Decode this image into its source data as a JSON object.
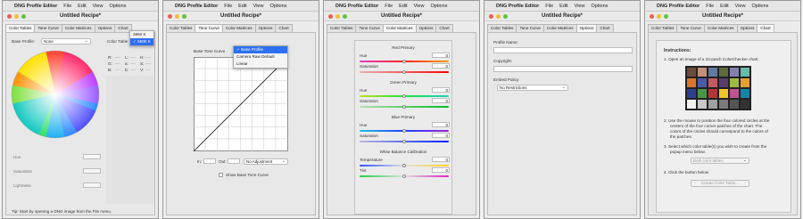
{
  "menubar": {
    "app_name": "DNG Profile Editor",
    "file": "File",
    "edit": "Edit",
    "view": "View",
    "options": "Options"
  },
  "window": {
    "title": "Untitled Recipe*"
  },
  "tabs": [
    "Color Tables",
    "Tone Curve",
    "Color Matrices",
    "Options",
    "Chart"
  ],
  "panel1": {
    "base_profile_label": "Base Profile:",
    "base_profile_value": "None",
    "color_table_label": "Color Table",
    "temp_options": [
      "2850 K",
      "6500 K"
    ],
    "rgb_labels": [
      "R:",
      "G:",
      "B:"
    ],
    "lab_labels": [
      "L:",
      "a:",
      "b:"
    ],
    "hsv_labels": [
      "H:",
      "S:",
      "V:"
    ],
    "placeholder": "----",
    "hue_label": "Hue",
    "saturation_label": "Saturation",
    "lightness_label": "Lightness",
    "tip": "Tip: Start by opening a DNG image from the File menu."
  },
  "panel2": {
    "base_tone_curve_label": "Base Tone Curve",
    "curve_options": [
      "Base Profile",
      "Camera Raw Default",
      "Linear"
    ],
    "in_label": "In:",
    "out_label": "Out:",
    "adjustment_value": "No Adjustment",
    "show_base_label": "Show Base Tone Curve"
  },
  "panel3": {
    "groups": [
      {
        "title": "Red Primary",
        "hue_label": "Hue",
        "hue_value": "0",
        "sat_label": "Saturation",
        "sat_value": "0"
      },
      {
        "title": "Green Primary",
        "hue_label": "Hue",
        "hue_value": "0",
        "sat_label": "Saturation",
        "sat_value": "0"
      },
      {
        "title": "Blue Primary",
        "hue_label": "Hue",
        "hue_value": "0",
        "sat_label": "Saturation",
        "sat_value": "0"
      }
    ],
    "wb_title": "White Balance Calibration",
    "temperature_label": "Temperature",
    "temperature_value": "0",
    "tint_label": "Tint",
    "tint_value": "0"
  },
  "panel4": {
    "profile_name_label": "Profile Name:",
    "copyright_label": "Copyright:",
    "embed_policy_label": "Embed Policy:",
    "embed_policy_value": "No Restrictions"
  },
  "panel5": {
    "instructions_title": "Instructions:",
    "step1": "1.   Open an image of a 24-patch ColorChecker chart.",
    "step2_lines": [
      "2.   Use the mouse to position the four colored circles at the",
      "centers of the four corner patches of the chart. The",
      "colors of the circles should correspond to the colors of",
      "the patches."
    ],
    "step3_lines": [
      "3.   Select which color table(s) you wish to create from the",
      "popup menu below."
    ],
    "both_tables": "Both color tables",
    "step4": "4.   Click the button below.",
    "create_button": "Create Color Table...",
    "checker_colors": [
      "#6b4b3a",
      "#c4907a",
      "#5e7aa0",
      "#5d6b3f",
      "#8381b0",
      "#67bba9",
      "#d7762c",
      "#4a5aa3",
      "#c35a62",
      "#5a3d6b",
      "#9ebb48",
      "#e5a030",
      "#2f3f8f",
      "#4a9548",
      "#b33538",
      "#efc52a",
      "#bb548f",
      "#0e86a5",
      "#f2f2f2",
      "#c8c8c8",
      "#a0a0a0",
      "#7a7a7a",
      "#555555",
      "#333333"
    ]
  }
}
